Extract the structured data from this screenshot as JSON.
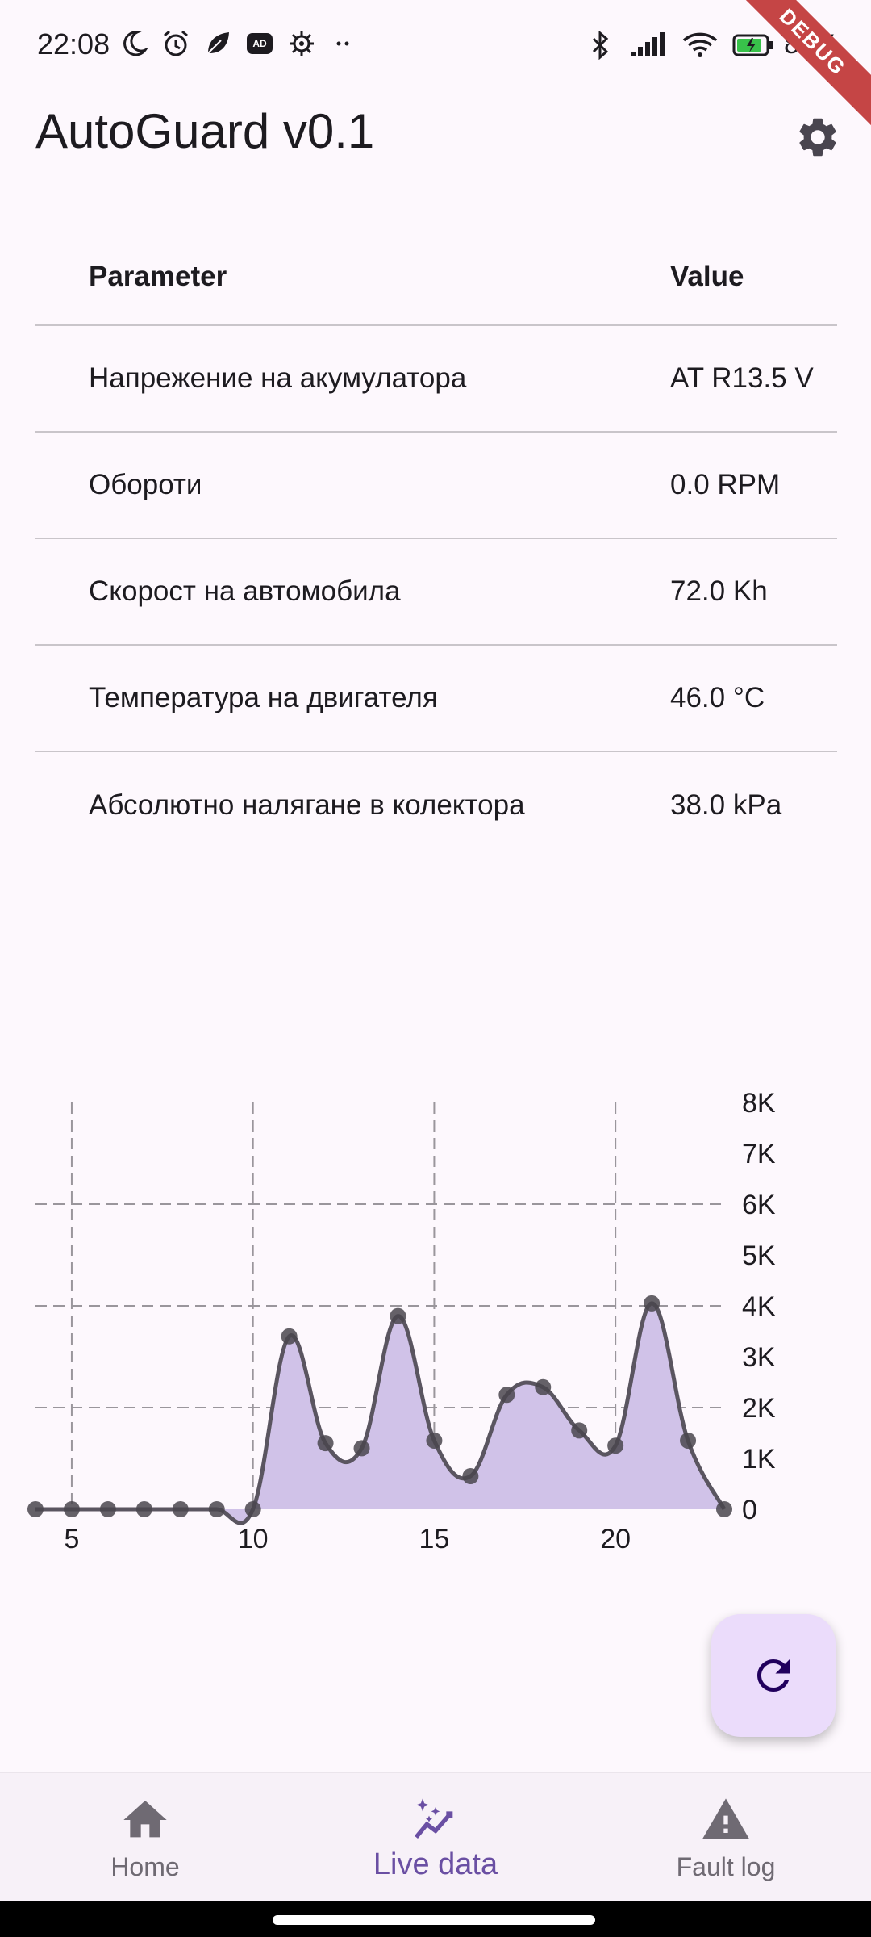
{
  "status_bar": {
    "time": "22:08",
    "left_icons": [
      "moon-icon",
      "alarm-icon",
      "leaf-icon",
      "adblock-icon",
      "gear-icon",
      "more-dots-icon"
    ],
    "right_icons": [
      "bluetooth-icon",
      "signal-icon",
      "wifi-icon",
      "battery-icon"
    ],
    "battery": "80%"
  },
  "debug_banner": "DEBUG",
  "app_bar": {
    "title": "AutoGuard v0.1",
    "settings_icon": "gear-icon"
  },
  "table": {
    "headers": {
      "param": "Parameter",
      "value": "Value"
    },
    "rows": [
      {
        "param": "Напрежение на акумулатора",
        "value": "AT R13.5 V"
      },
      {
        "param": "Обороти",
        "value": "0.0 RPM"
      },
      {
        "param": "Скорост на автомобила",
        "value": "72.0 Kh"
      },
      {
        "param": "Температура на двигателя",
        "value": "46.0 °C"
      },
      {
        "param": "Абсолютно налягане в колектора",
        "value": "38.0 kPa"
      }
    ]
  },
  "chart_data": {
    "type": "area",
    "x": [
      4,
      5,
      6,
      7,
      8,
      9,
      10,
      11,
      12,
      13,
      14,
      15,
      16,
      17,
      18,
      19,
      20,
      21,
      22,
      23
    ],
    "values": [
      0,
      0,
      0,
      0,
      0,
      0,
      0,
      3400,
      1300,
      1200,
      3800,
      1350,
      650,
      2250,
      2400,
      1550,
      1250,
      4050,
      1350,
      0
    ],
    "xlim": [
      4,
      23
    ],
    "ylim": [
      0,
      8000
    ],
    "x_ticks": [
      "5",
      "10",
      "15",
      "20"
    ],
    "x_tick_values": [
      5,
      10,
      15,
      20
    ],
    "y_ticks": [
      "0",
      "1K",
      "2K",
      "3K",
      "4K",
      "5K",
      "6K",
      "7K",
      "8K"
    ],
    "y_tick_values": [
      0,
      1000,
      2000,
      3000,
      4000,
      5000,
      6000,
      7000,
      8000
    ],
    "grid_y_values": [
      2000,
      4000,
      6000
    ],
    "grid_x_values": [
      5,
      10,
      15,
      20
    ],
    "line_color": "#5a5560",
    "fill_color": "#d0c2e8",
    "point_color": "#4a464e",
    "grid": true,
    "y_axis_position": "right",
    "title": "",
    "xlabel": "",
    "ylabel": ""
  },
  "fab": {
    "icon": "refresh-icon"
  },
  "bottom_nav": {
    "items": [
      {
        "label": "Home",
        "icon": "home-icon",
        "active": false
      },
      {
        "label": "Live data",
        "icon": "sparkle-chart-icon",
        "active": true
      },
      {
        "label": "Fault log",
        "icon": "warning-icon",
        "active": false
      }
    ]
  },
  "colors": {
    "accent": "#6a4fa3",
    "fab_bg": "#ebdcfb",
    "background": "#fdf8fd"
  }
}
